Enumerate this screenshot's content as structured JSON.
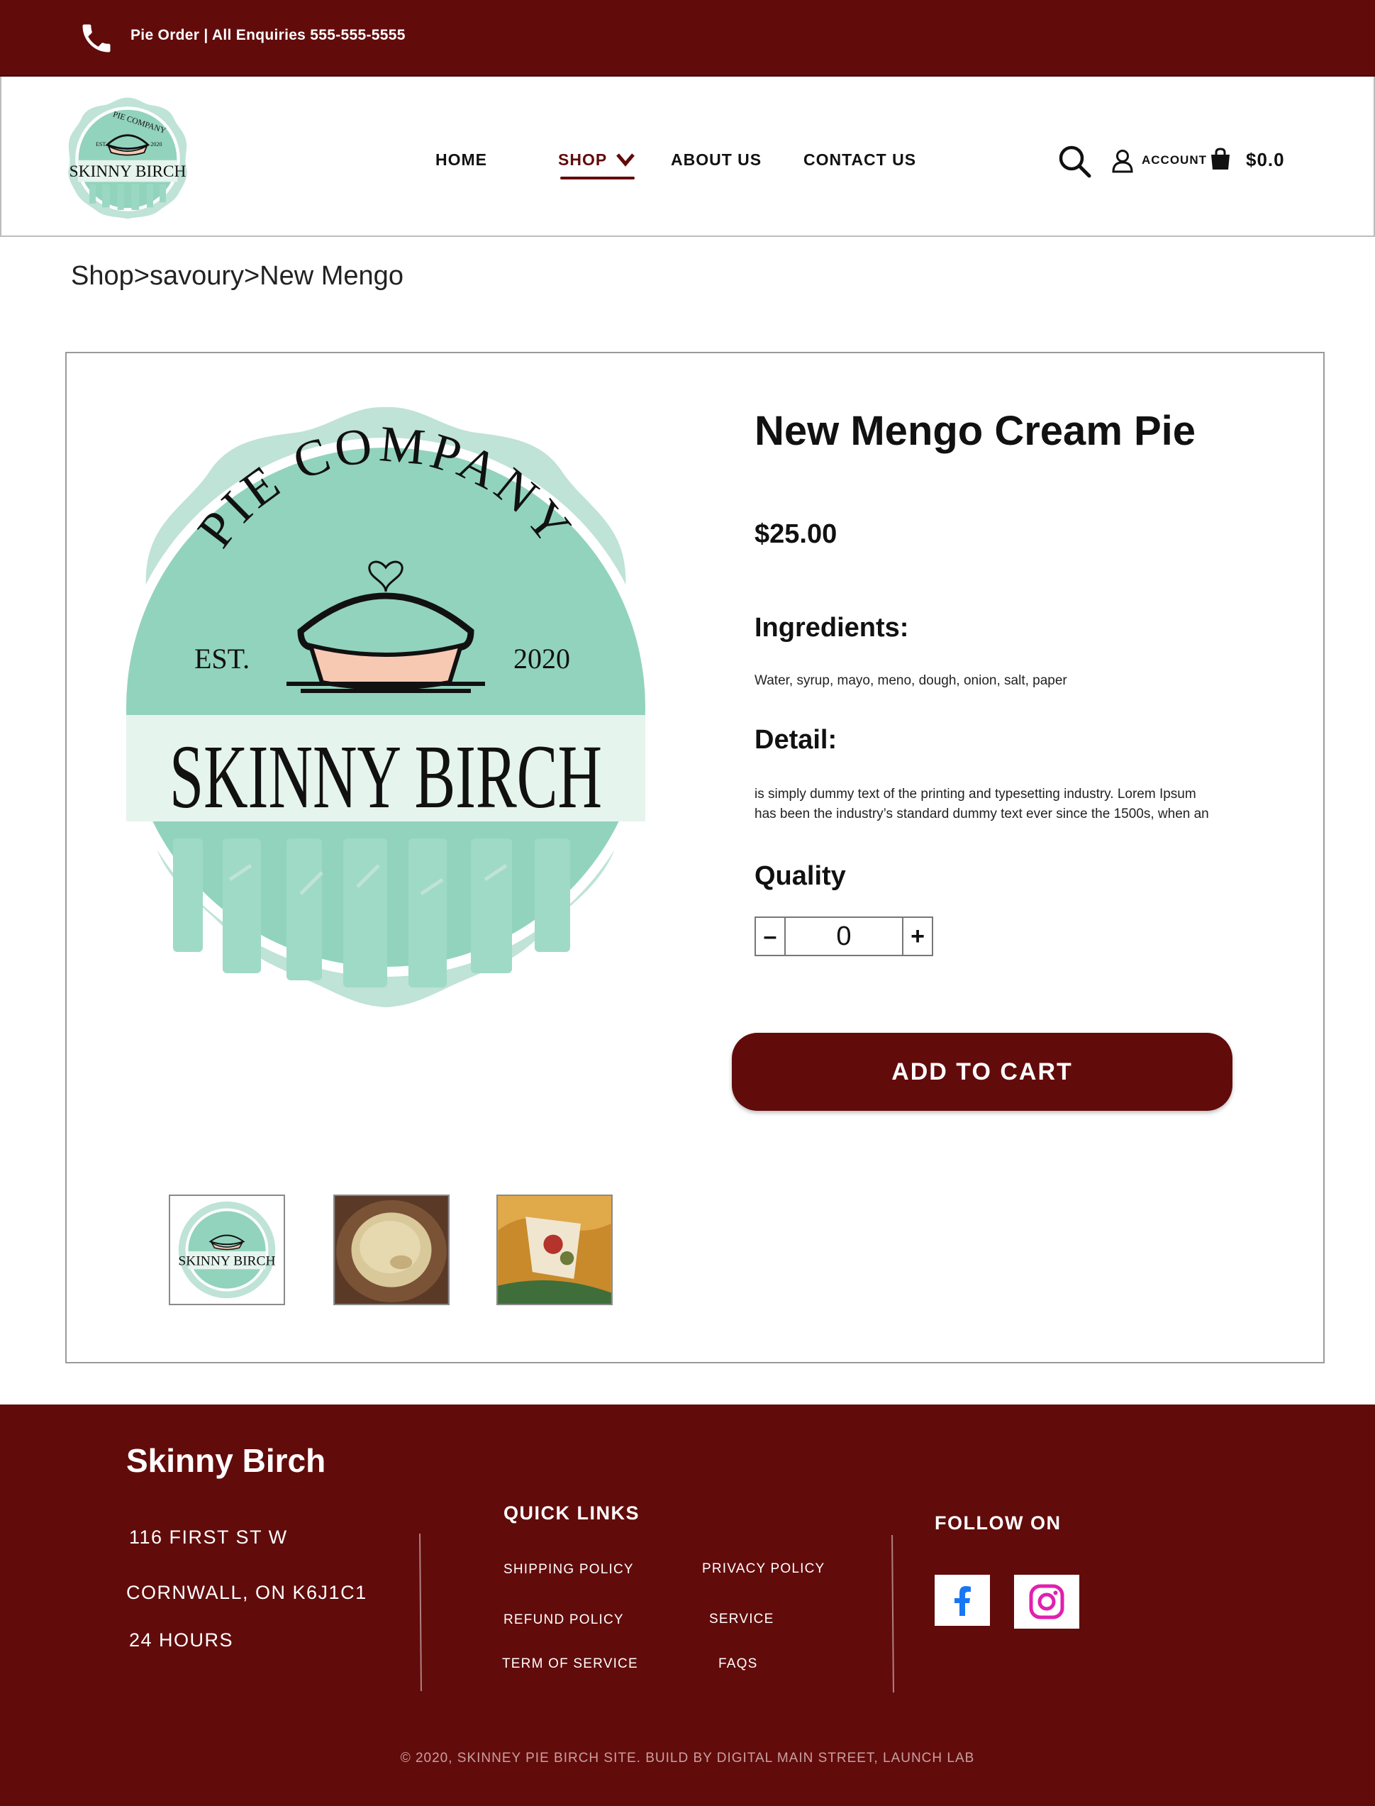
{
  "topbar": {
    "text": "Pie Order | All Enquiries  555-555-5555"
  },
  "nav": {
    "home": "HOME",
    "shop": "SHOP",
    "about": "ABOUT US",
    "contact": "CONTACT US",
    "account": "ACCOUNT",
    "cart_total": "$0.0"
  },
  "logo": {
    "arc_text": "PIE COMPANY",
    "est": "EST.",
    "year": "2020",
    "name": "SKINNY BIRCH"
  },
  "breadcrumb": "Shop>savoury>New Mengo",
  "product": {
    "title": "New Mengo Cream Pie",
    "price": "$25.00",
    "ingredients_title": "Ingredients:",
    "ingredients": "Water, syrup, mayo, meno, dough, onion, salt, paper",
    "detail_title": "Detail:",
    "detail_line1": "is simply dummy text of the printing and typesetting industry. Lorem Ipsum",
    "detail_line2": "has been the industry’s standard dummy text ever since the 1500s, when an",
    "quality_title": "Quality",
    "quantity": "0",
    "minus": "–",
    "plus": "+",
    "add_to_cart": "ADD TO CART"
  },
  "footer": {
    "brand": "Skinny Birch",
    "address1": "116 FIRST ST W",
    "address2": "CORNWALL, ON K6J1C1",
    "hours": "24 HOURS",
    "quick_links_title": "QUICK LINKS",
    "links": [
      "SHIPPING POLICY",
      "PRIVACY POLICY",
      "REFUND POLICY",
      "SERVICE",
      "TERM OF SERVICE",
      "FAQS"
    ],
    "follow_title": "FOLLOW ON",
    "copyright": "© 2020, SKINNEY PIE BIRCH SITE. BUILD BY DIGITAL MAIN STREET, LAUNCH LAB"
  },
  "colors": {
    "brand_maroon": "#620b0b",
    "mint": "#92d3bd",
    "mint_light": "#bfe3d6",
    "facebook_blue": "#1877f2",
    "instagram_pink": "#e020b0"
  }
}
